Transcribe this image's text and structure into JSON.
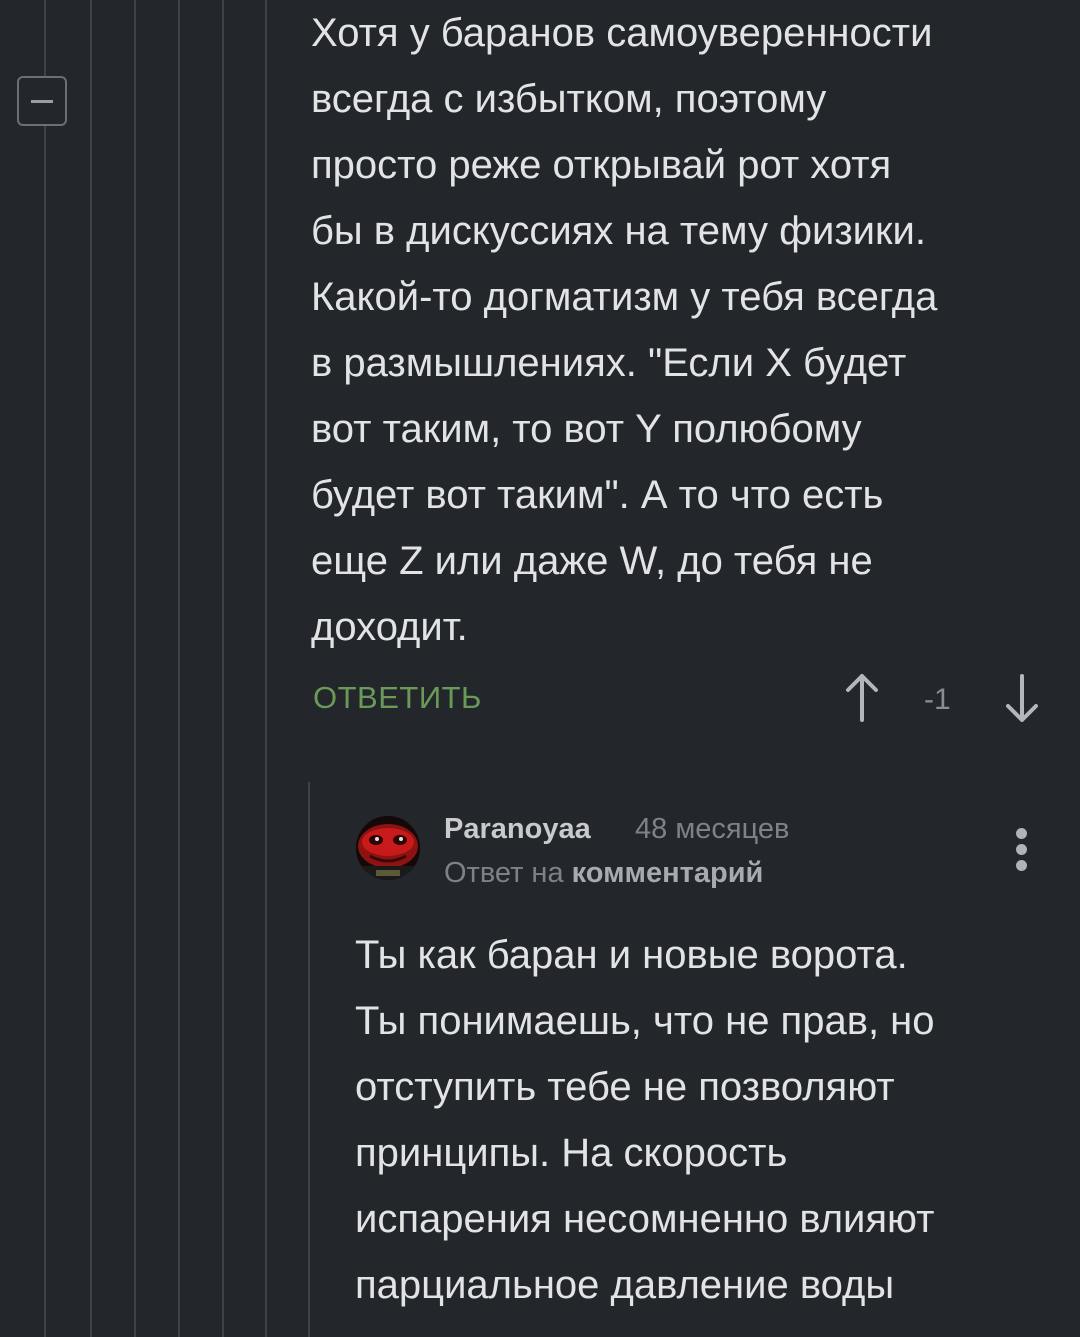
{
  "comment_parent": {
    "lines": [
      "Хотя у баранов самоуверенности",
      "всегда с избытком, поэтому",
      "просто реже открывай рот хотя",
      "бы в дискуссиях на тему физики.",
      "Какой-то догматизм у тебя всегда",
      "в размышлениях. \"Если X будет",
      "вот таким, то вот Y полюбому",
      "будет вот таким\". А то что есть",
      "еще Z или даже W, до тебя не",
      "доходит."
    ],
    "reply_label": "ОТВЕТИТЬ",
    "rating": "-1"
  },
  "comment_child": {
    "username": "Paranoyaa",
    "timestamp": "48 месяцев",
    "reply_to_prefix": "Ответ на",
    "reply_to_link": "комментарий",
    "lines": [
      "Ты как баран и новые ворота.",
      "Ты понимаешь, что не прав, но",
      "отступить тебе не позволяют",
      "принципы. На скорость",
      "испарения несомненно влияют",
      "парциальное давление воды"
    ]
  },
  "icons": {
    "collapse": "minus-square-icon",
    "upvote": "arrow-up-icon",
    "downvote": "arrow-down-icon",
    "menu": "more-vertical-icon"
  },
  "colors": {
    "background": "#23262a",
    "text": "#e2e3e4",
    "reply_accent": "#6a9a58",
    "muted": "#7e8287"
  }
}
